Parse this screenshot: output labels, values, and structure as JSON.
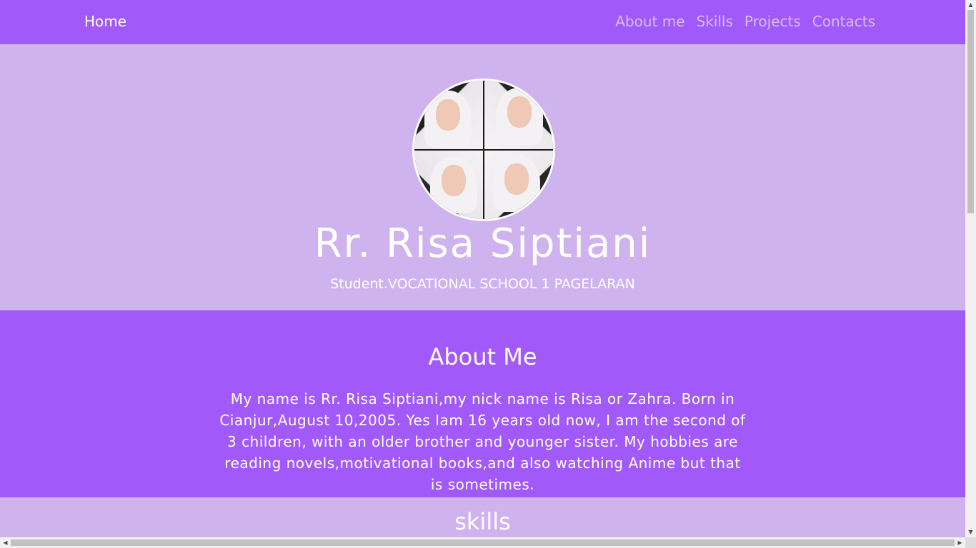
{
  "navbar": {
    "brand": "Home",
    "links": [
      "About me",
      "Skills",
      "Projects",
      "Contacts"
    ]
  },
  "hero": {
    "name": "Rr. Risa Siptiani",
    "subtitle": "Student.VOCATIONAL SCHOOL 1 PAGELARAN"
  },
  "about": {
    "heading": "About Me",
    "text": "My name is Rr. Risa Siptiani,my nick name is Risa or Zahra. Born in Cianjur,August 10,2005. Yes Iam 16 years old now, I am the second of 3 children, with an older brother and younger sister. My hobbies are reading novels,motivational books,and also watching Anime but that is sometimes."
  },
  "skills": {
    "heading": "skills"
  },
  "colors": {
    "primary": "#a259f9",
    "light": "#cfb3ee",
    "nav_link": "#d6bdf7",
    "text": "#ffffff"
  },
  "icons": {
    "scroll_up": "triangle-up-icon",
    "scroll_down": "triangle-down-icon",
    "scroll_left": "triangle-left-icon",
    "scroll_right": "triangle-right-icon"
  }
}
